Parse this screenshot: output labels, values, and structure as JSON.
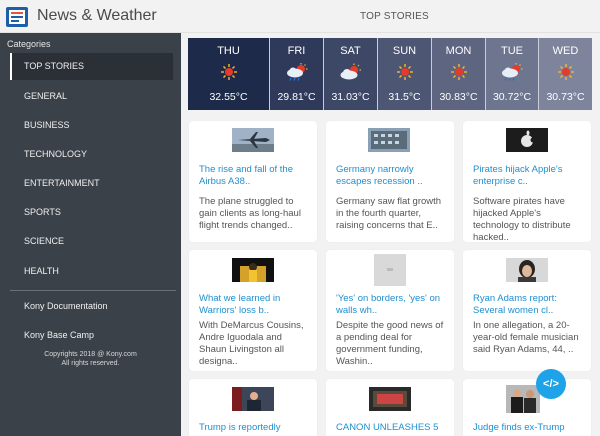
{
  "header": {
    "app_title": "News & Weather",
    "section_title": "TOP STORIES"
  },
  "sidebar": {
    "heading": "Categories",
    "items": [
      {
        "label": "TOP STORIES"
      },
      {
        "label": "GENERAL"
      },
      {
        "label": "BUSINESS"
      },
      {
        "label": "TECHNOLOGY"
      },
      {
        "label": "ENTERTAINMENT"
      },
      {
        "label": "SPORTS"
      },
      {
        "label": "SCIENCE"
      },
      {
        "label": "HEALTH"
      }
    ],
    "links": [
      {
        "label": "Kony Documentation"
      },
      {
        "label": "Kony Base Camp"
      }
    ],
    "copyright_line1": "Copyrights 2018 @ Kony.com",
    "copyright_line2": "All rights reserved."
  },
  "weather": [
    {
      "day": "THU",
      "temp": "32.55°C",
      "icon": "sun-icon",
      "color": "#1e2a4a"
    },
    {
      "day": "FRI",
      "temp": "29.81°C",
      "icon": "rain-cloud-sun-icon",
      "color": "#2f3a5a"
    },
    {
      "day": "SAT",
      "temp": "31.03°C",
      "icon": "cloud-sun-icon",
      "color": "#3d4866"
    },
    {
      "day": "SUN",
      "temp": "31.5°C",
      "icon": "sun-icon",
      "color": "#4d5672"
    },
    {
      "day": "MON",
      "temp": "30.83°C",
      "icon": "sun-icon",
      "color": "#5d6580"
    },
    {
      "day": "TUE",
      "temp": "30.72°C",
      "icon": "rain-cloud-sun-icon",
      "color": "#6e758e"
    },
    {
      "day": "WED",
      "temp": "30.73°C",
      "icon": "sun-icon",
      "color": "#7d849c"
    }
  ],
  "articles": [
    {
      "title": "The rise and fall of the Airbus A38..",
      "desc": "The plane struggled to gain clients as long-haul flight trends changed..",
      "image": "airplane-image"
    },
    {
      "title": "Germany narrowly escapes recession ..",
      "desc": "Germany saw flat growth in the fourth quarter, raising concerns that E..",
      "image": "building-image"
    },
    {
      "title": "Pirates hijack Apple's enterprise c..",
      "desc": "Software pirates have hijacked Apple's technology to distribute hacked..",
      "image": "apple-logo-image"
    },
    {
      "title": "What we learned in Warriors' loss b..",
      "desc": "With DeMarcus Cousins, Andre Iguodala and Shaun Livingston all designa..",
      "image": "basketball-image"
    },
    {
      "title": "'Yes' on borders, 'yes' on walls wh..",
      "desc": "Despite the good news of a pending deal for government funding, Washin..",
      "image": "placeholder-image"
    },
    {
      "title": "Ryan Adams report: Several women cl..",
      "desc": "In one allegation, a 20-year-old female musician said Ryan Adams, 44, ..",
      "image": "portrait-image"
    },
    {
      "title": "Trump is reportedly",
      "desc": "",
      "image": "press-image"
    },
    {
      "title": "CANON UNLEASHES 5",
      "desc": "",
      "image": "camera-image"
    },
    {
      "title": "Judge finds ex-Trump",
      "desc": "",
      "image": "people-image"
    }
  ],
  "fab": {
    "label": "</>"
  },
  "colors": {
    "sidebar_bg": "#3b4148",
    "link_blue": "#1d8fd0",
    "fab_blue": "#1fa3e8"
  }
}
